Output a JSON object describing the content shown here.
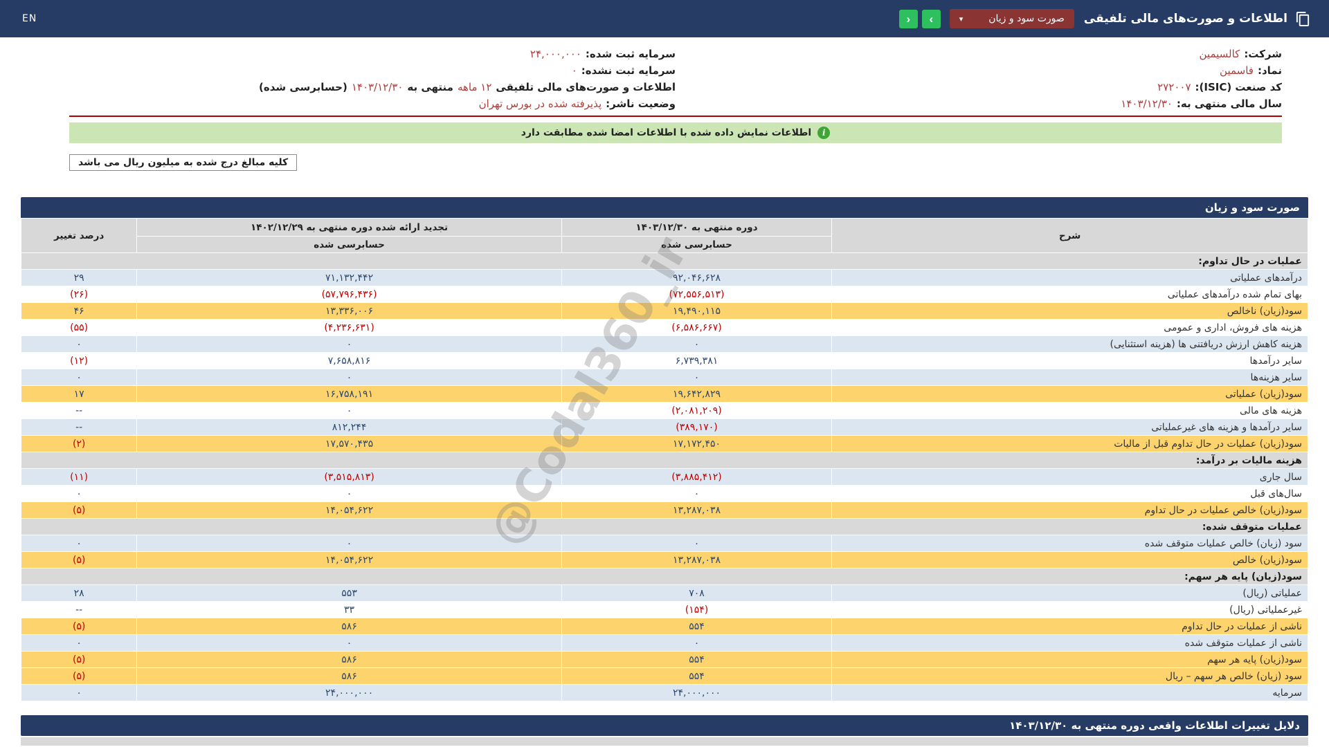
{
  "header": {
    "title": "اطلاعات و صورت‌های مالی تلفیقی",
    "statement_dropdown": "صورت سود و زیان",
    "nav_forward": "›",
    "nav_back": "‹",
    "language": "EN"
  },
  "company_info": {
    "company_label": "شرکت:",
    "company_value": "کالسیمین",
    "symbol_label": "نماد:",
    "symbol_value": "فاسمین",
    "isic_label": "کد صنعت (ISIC):",
    "isic_value": "۲۷۲۰۰۷",
    "fiscal_year_label": "سال مالی منتهی به:",
    "fiscal_year_value": "۱۴۰۳/۱۲/۳۰",
    "registered_capital_label": "سرمایه ثبت شده:",
    "registered_capital_value": "۲۴,۰۰۰,۰۰۰",
    "unregistered_capital_label": "سرمایه ثبت نشده:",
    "unregistered_capital_value": "۰",
    "period_label": "اطلاعات و صورت‌های مالی تلفیقی",
    "period_value": "۱۲ ماهه",
    "period_middle": "منتهی به",
    "period_date": "۱۴۰۳/۱۲/۳۰",
    "period_suffix": "(حسابرسی شده)",
    "publisher_status_label": "وضعیت ناشر:",
    "publisher_status_value": "پذیرفته شده در بورس تهران"
  },
  "notice": {
    "text": "اطلاعات نمایش داده شده با اطلاعات امضا شده مطابقت دارد"
  },
  "unit_note": {
    "text": "کلیه مبالغ درج شده به میلیون ریال می باشد"
  },
  "table": {
    "title": "صورت سود و زیان",
    "headers": {
      "desc": "شرح",
      "current_period": "دوره منتهی به ۱۴۰۳/۱۲/۳۰",
      "restated_period": "تجدید ارائه شده دوره منتهی به ۱۴۰۲/۱۲/۲۹",
      "audited": "حسابرسی شده",
      "change": "درصد تغییر"
    },
    "rows": [
      {
        "type": "section",
        "desc": "عملیات در حال تداوم:"
      },
      {
        "type": "data",
        "bg": "blue",
        "desc": "درآمدهای عملیاتی",
        "current": "۹۲,۰۴۶,۶۲۸",
        "restated": "۷۱,۱۳۲,۴۴۲",
        "change": "۲۹"
      },
      {
        "type": "data",
        "bg": "white",
        "desc": "بهای تمام شده درآمدهای عملیاتی",
        "current": "(۷۲,۵۵۶,۵۱۳)",
        "restated": "(۵۷,۷۹۶,۴۳۶)",
        "change": "(۲۶)"
      },
      {
        "type": "data",
        "bg": "yellow",
        "desc": "سود(زیان) ناخالص",
        "current": "۱۹,۴۹۰,۱۱۵",
        "restated": "۱۳,۳۳۶,۰۰۶",
        "change": "۴۶"
      },
      {
        "type": "data",
        "bg": "white",
        "desc": "هزینه های فروش، اداری و عمومی",
        "current": "(۶,۵۸۶,۶۶۷)",
        "restated": "(۴,۲۳۶,۶۳۱)",
        "change": "(۵۵)"
      },
      {
        "type": "data",
        "bg": "blue",
        "desc": "هزینه کاهش ارزش دریافتنی ها (هزینه استثنایی)",
        "current": "۰",
        "restated": "۰",
        "change": "۰"
      },
      {
        "type": "data",
        "bg": "white",
        "desc": "سایر درآمدها",
        "current": "۶,۷۳۹,۳۸۱",
        "restated": "۷,۶۵۸,۸۱۶",
        "change": "(۱۲)"
      },
      {
        "type": "data",
        "bg": "blue",
        "desc": "سایر هزینه‌ها",
        "current": "۰",
        "restated": "۰",
        "change": "۰"
      },
      {
        "type": "data",
        "bg": "yellow",
        "desc": "سود(زیان) عملیاتی",
        "current": "۱۹,۶۴۲,۸۲۹",
        "restated": "۱۶,۷۵۸,۱۹۱",
        "change": "۱۷"
      },
      {
        "type": "data",
        "bg": "white",
        "desc": "هزینه های مالی",
        "current": "(۲,۰۸۱,۲۰۹)",
        "restated": "۰",
        "change": "--"
      },
      {
        "type": "data",
        "bg": "blue",
        "desc": "سایر درآمدها و هزینه های غیرعملیاتی",
        "current": "(۳۸۹,۱۷۰)",
        "restated": "۸۱۲,۲۴۴",
        "change": "--"
      },
      {
        "type": "data",
        "bg": "yellow",
        "desc": "سود(زیان) عملیات در حال تداوم قبل از مالیات",
        "current": "۱۷,۱۷۲,۴۵۰",
        "restated": "۱۷,۵۷۰,۴۳۵",
        "change": "(۲)"
      },
      {
        "type": "section",
        "desc": "هزینه مالیات بر درآمد:"
      },
      {
        "type": "data",
        "bg": "blue",
        "desc": "سال جاری",
        "current": "(۳,۸۸۵,۴۱۲)",
        "restated": "(۳,۵۱۵,۸۱۳)",
        "change": "(۱۱)"
      },
      {
        "type": "data",
        "bg": "white",
        "desc": "سال‌های قبل",
        "current": "۰",
        "restated": "۰",
        "change": "۰"
      },
      {
        "type": "data",
        "bg": "yellow",
        "desc": "سود(زیان) خالص عملیات در حال تداوم",
        "current": "۱۳,۲۸۷,۰۳۸",
        "restated": "۱۴,۰۵۴,۶۲۲",
        "change": "(۵)"
      },
      {
        "type": "section",
        "desc": "عملیات متوقف شده:"
      },
      {
        "type": "data",
        "bg": "blue",
        "desc": "سود (زیان) خالص عملیات متوقف شده",
        "current": "۰",
        "restated": "۰",
        "change": "۰"
      },
      {
        "type": "data",
        "bg": "yellow",
        "desc": "سود(زیان) خالص",
        "current": "۱۳,۲۸۷,۰۳۸",
        "restated": "۱۴,۰۵۴,۶۲۲",
        "change": "(۵)"
      },
      {
        "type": "section",
        "desc": "سود(زیان) پایه هر سهم:"
      },
      {
        "type": "data",
        "bg": "blue",
        "desc": "عملیاتی (ریال)",
        "current": "۷۰۸",
        "restated": "۵۵۳",
        "change": "۲۸"
      },
      {
        "type": "data",
        "bg": "white",
        "desc": "غیرعملیاتی (ریال)",
        "current": "(۱۵۴)",
        "restated": "۳۳",
        "change": "--"
      },
      {
        "type": "data",
        "bg": "yellow",
        "desc": "ناشی از عملیات در حال تداوم",
        "current": "۵۵۴",
        "restated": "۵۸۶",
        "change": "(۵)"
      },
      {
        "type": "data",
        "bg": "blue",
        "desc": "ناشی از عملیات متوقف شده",
        "current": "۰",
        "restated": "۰",
        "change": "۰"
      },
      {
        "type": "data",
        "bg": "yellow",
        "desc": "سود(زیان) پایه هر سهم",
        "current": "۵۵۴",
        "restated": "۵۸۶",
        "change": "(۵)"
      },
      {
        "type": "data",
        "bg": "yellow",
        "desc": "سود (زیان) خالص هر سهم – ریال",
        "current": "۵۵۴",
        "restated": "۵۸۶",
        "change": "(۵)"
      },
      {
        "type": "data",
        "bg": "blue",
        "desc": "سرمایه",
        "current": "۲۴,۰۰۰,۰۰۰",
        "restated": "۲۴,۰۰۰,۰۰۰",
        "change": "۰"
      }
    ]
  },
  "footer": {
    "title": "دلایل تغییرات اطلاعات واقعی دوره منتهی به ۱۴۰۳/۱۲/۳۰"
  },
  "watermark": "@Codal360_ir",
  "colors": {
    "header_navy": "#263C64",
    "dropdown_maroon": "#8A3433",
    "accent_green": "#2EBF5F",
    "notice_green": "#CBE5B5",
    "row_blue": "#DCE6F1",
    "highlight_yellow": "#FCD36C",
    "section_gray": "#D9D9D9",
    "negative_red": "#C00000",
    "info_value_red": "#AA3E3C",
    "value_navy": "#2C4770"
  }
}
